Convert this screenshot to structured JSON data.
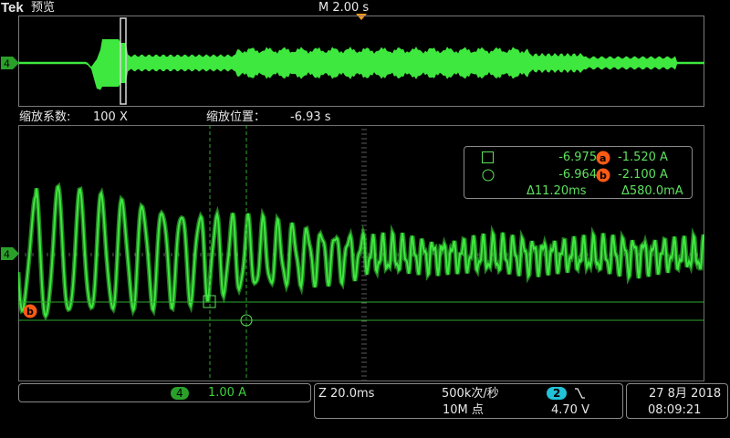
{
  "header": {
    "brand": "Tek",
    "mode": "预览",
    "timebase": "M 2.00 s"
  },
  "overview": {
    "channel_marker": "4"
  },
  "zoom_info": {
    "factor_label": "缩放系数:",
    "factor_value": "100 X",
    "position_label": "缩放位置：",
    "position_value": "-6.93 s"
  },
  "main": {
    "channel_marker": "4",
    "cursor_b_marker": "b"
  },
  "cursor_readout": {
    "row1": {
      "time": "-6.975 s",
      "badge": "a",
      "value": "-1.520 A"
    },
    "row2": {
      "time": "-6.964 s",
      "badge": "b",
      "value": "-2.100 A"
    },
    "delta_time": "Δ11.20ms",
    "delta_value": "Δ580.0mA"
  },
  "status_bar": {
    "channel": {
      "badge": "4",
      "scale": "1.00 A"
    },
    "zoom_timebase": "Z 20.0ms",
    "sample_rate": "500k次/秒",
    "record_length": "10M 点",
    "trigger": {
      "badge": "2",
      "slope_icon": "falling-edge-icon",
      "level": "4.70 V"
    },
    "date": "27 8月 2018",
    "time": "08:09:21"
  },
  "colors": {
    "trace": "#3ee83e",
    "cursor_badge": "#ff5a14",
    "trigger_marker": "#ff9a1e",
    "channel2": "#21c3d8"
  }
}
